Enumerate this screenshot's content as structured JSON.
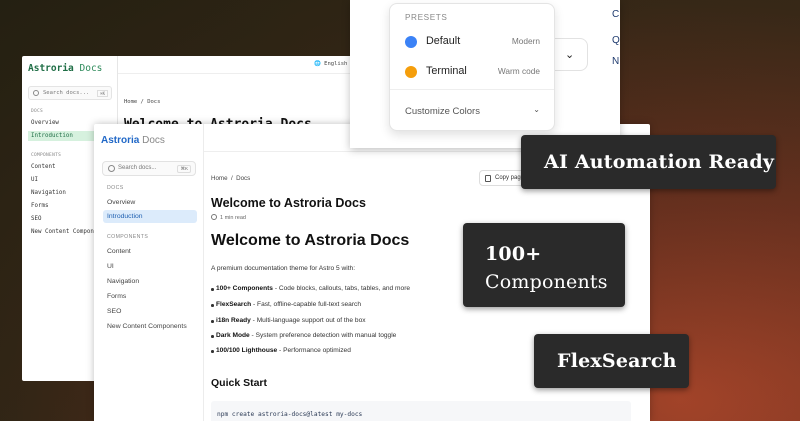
{
  "back_window": {
    "brand": "Astroria",
    "brand_suffix": "Docs",
    "search_placeholder": "Search docs...",
    "search_shortcut": "⌘K",
    "language": "English",
    "section_docs": "DOCS",
    "items_docs": [
      "Overview",
      "Introduction"
    ],
    "section_components": "COMPONENTS",
    "items_components": [
      "Content",
      "UI",
      "Navigation",
      "Forms",
      "SEO",
      "New Content Components"
    ],
    "breadcrumb": [
      "Home",
      "Docs"
    ],
    "title": "Welcome to Astroria Docs"
  },
  "front_window": {
    "brand": "Astroria",
    "brand_suffix": "Docs",
    "search_placeholder": "Search docs...",
    "search_shortcut": "⌘K",
    "section_docs": "DOCS",
    "items_docs": [
      "Overview",
      "Introduction"
    ],
    "section_components": "COMPONENTS",
    "items_components": [
      "Content",
      "UI",
      "Navigation",
      "Forms",
      "SEO",
      "New Content Components"
    ],
    "breadcrumb": [
      "Home",
      "Docs"
    ],
    "copy_label": "Copy page",
    "page_title": "Welcome to Astroria Docs",
    "read_time": "1 min read",
    "heading": "Welcome to Astroria Docs",
    "description": "A premium documentation theme for Astro 5 with:",
    "features": [
      {
        "bold": "100+ Components",
        "text": " - Code blocks, callouts, tabs, tables, and more"
      },
      {
        "bold": "FlexSearch",
        "text": " - Fast, offline-capable full-text search"
      },
      {
        "bold": "i18n Ready",
        "text": " - Multi-language support out of the box"
      },
      {
        "bold": "Dark Mode",
        "text": " - System preference detection with manual toggle"
      },
      {
        "bold": "100/100 Lighthouse",
        "text": " - Performance optimized"
      }
    ],
    "quick_start": "Quick Start",
    "code": "npm create astroria-docs@latest my-docs"
  },
  "presets": {
    "header": "PRESETS",
    "options": [
      {
        "name": "Default",
        "note": "Modern",
        "color": "#3b82f6"
      },
      {
        "name": "Terminal",
        "note": "Warm code",
        "color": "#f59e0b"
      }
    ],
    "customize": "Customize Colors",
    "edge_letters": [
      "C",
      "Q",
      "N"
    ]
  },
  "callouts": {
    "automation": "AI Automation Ready",
    "components_line1": "100+",
    "components_line2": "Components",
    "flexsearch": "FlexSearch"
  }
}
